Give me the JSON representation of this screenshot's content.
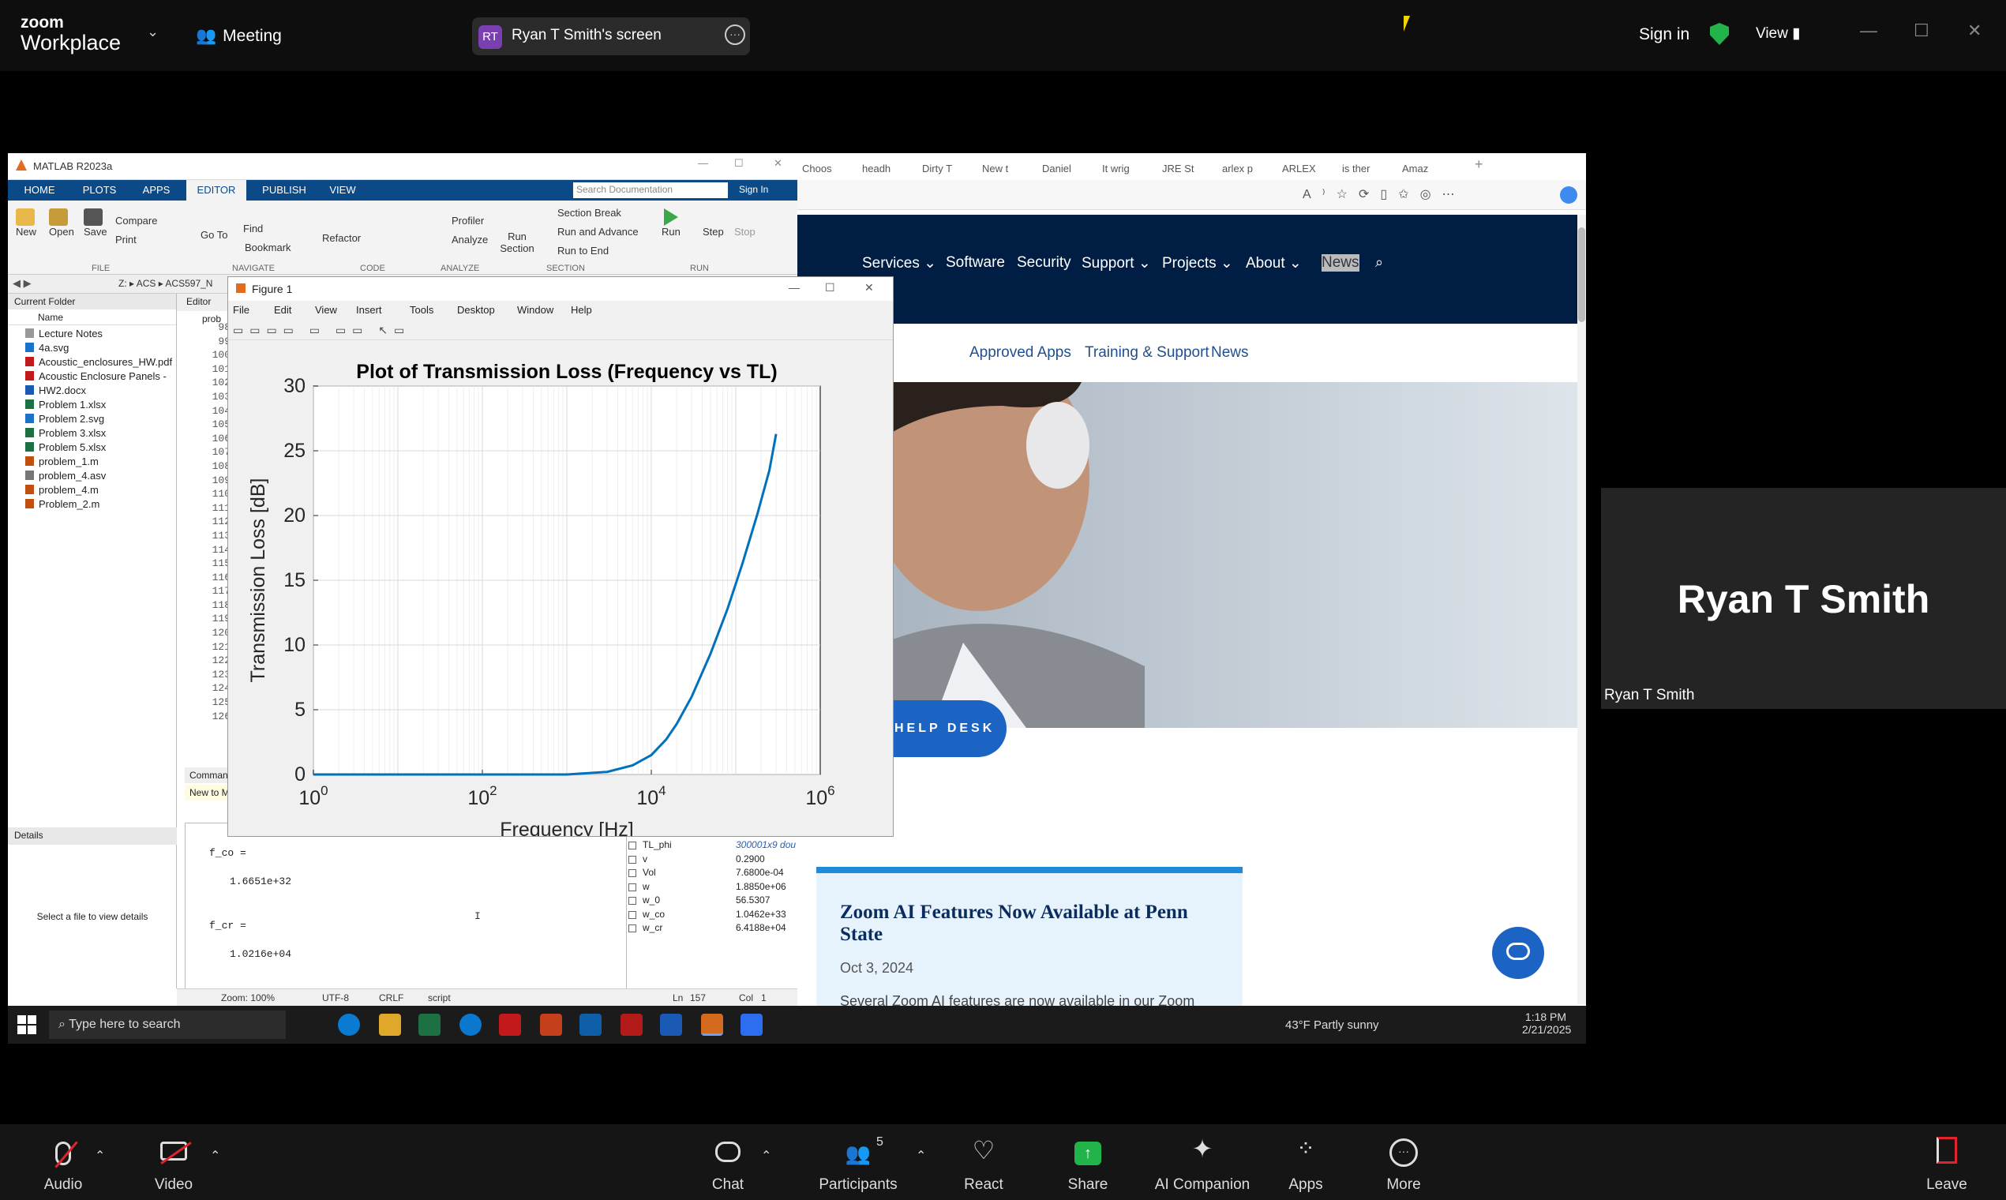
{
  "zoom": {
    "brand_top": "zoom",
    "brand_bottom": "Workplace",
    "meeting_label": "Meeting",
    "share_avatar": "RT",
    "share_label": "Ryan T Smith's screen",
    "sign_in": "Sign in",
    "view": "View",
    "tile_name_large": "Ryan T Smith",
    "tile_name_small": "Ryan T Smith",
    "bottom": [
      {
        "label": "Audio",
        "icon": "muted-mic-icon"
      },
      {
        "label": "Video",
        "icon": "video-off-icon"
      },
      {
        "label": "Chat",
        "icon": "chat-icon"
      },
      {
        "label": "Participants",
        "icon": "participants-icon",
        "count": "5"
      },
      {
        "label": "React",
        "icon": "heart-icon"
      },
      {
        "label": "Share",
        "icon": "share-icon"
      },
      {
        "label": "AI Companion",
        "icon": "sparkle-icon"
      },
      {
        "label": "Apps",
        "icon": "apps-icon"
      },
      {
        "label": "More",
        "icon": "more-icon"
      },
      {
        "label": "Leave",
        "icon": "leave-icon"
      }
    ]
  },
  "matlab": {
    "title": "MATLAB R2023a",
    "tabs": [
      "HOME",
      "PLOTS",
      "APPS",
      "EDITOR",
      "PUBLISH",
      "VIEW"
    ],
    "search_placeholder": "Search Documentation",
    "sign_in": "Sign In",
    "ribbon": {
      "new": "New",
      "open": "Open",
      "save": "Save",
      "compare": "Compare",
      "print": "Print",
      "goto": "Go To",
      "find": "Find",
      "bookmark": "Bookmark",
      "refactor": "Refactor",
      "profiler": "Profiler",
      "analyze": "Analyze",
      "run_section": "Run Section",
      "section_break": "Section Break",
      "run_advance": "Run and Advance",
      "run_end": "Run to End",
      "run": "Run",
      "step": "Step",
      "stop": "Stop"
    },
    "groups": [
      "FILE",
      "NAVIGATE",
      "CODE",
      "ANALYZE",
      "SECTION",
      "RUN"
    ],
    "path": [
      "Z:",
      "ACS",
      "ACS597_N"
    ],
    "current_folder": "Current Folder",
    "name_col": "Name",
    "files": [
      "Lecture Notes",
      "4a.svg",
      "Acoustic_enclosures_HW.pdf",
      "Acoustic Enclosure Panels - ...",
      "HW2.docx",
      "Problem 1.xlsx",
      "Problem 2.svg",
      "Problem 3.xlsx",
      "Problem 5.xlsx",
      "problem_1.m",
      "problem_4.asv",
      "problem_4.m",
      "Problem_2.m"
    ],
    "details": "Details",
    "details_msg": "Select a file to view details",
    "editor_tab": "Editor",
    "editor_file": "prob",
    "line_numbers": [
      "98",
      "99",
      "100",
      "101",
      "102",
      "103",
      "104",
      "105",
      "106",
      "107",
      "108",
      "109",
      "110",
      "111",
      "112",
      "113",
      "114",
      "115",
      "116",
      "117",
      "118",
      "119",
      "120",
      "121",
      "122",
      "123",
      "124",
      "125",
      "126"
    ],
    "command_label": "Comman",
    "new_to": "New to M",
    "cmd_lines": [
      "f_co =",
      "1.6651e+32",
      "f_cr =",
      "1.0216e+04"
    ],
    "prompt": ">>",
    "workspace": [
      {
        "name": "TL_phi",
        "value": "300001x9 dou"
      },
      {
        "name": "v",
        "value": "0.2900"
      },
      {
        "name": "Vol",
        "value": "7.6800e-04"
      },
      {
        "name": "w",
        "value": "1.8850e+06"
      },
      {
        "name": "w_0",
        "value": "56.5307"
      },
      {
        "name": "w_co",
        "value": "1.0462e+33"
      },
      {
        "name": "w_cr",
        "value": "6.4188e+04"
      }
    ],
    "status": {
      "zoom": "Zoom: 100%",
      "enc": "UTF-8",
      "eol": "CRLF",
      "type": "script",
      "ln": "Ln",
      "ln_val": "157",
      "col": "Col",
      "col_val": "1"
    }
  },
  "figure": {
    "title": "Figure 1",
    "menus": [
      "File",
      "Edit",
      "View",
      "Insert",
      "Tools",
      "Desktop",
      "Window",
      "Help"
    ]
  },
  "chart_data": {
    "type": "line",
    "title": "Plot of Transmission Loss (Frequency vs TL)",
    "xlabel": "Frequency [Hz]",
    "ylabel": "Transmission Loss [dB]",
    "xscale": "log",
    "xlim": [
      1,
      1000000
    ],
    "ylim": [
      0,
      30
    ],
    "xticks": [
      "10^0",
      "10^2",
      "10^4",
      "10^6"
    ],
    "yticks": [
      "0",
      "5",
      "10",
      "15",
      "20",
      "25",
      "30"
    ],
    "grid": true,
    "color": "#0072bd",
    "x": [
      1,
      100,
      1000,
      3000,
      6000,
      10000,
      15000,
      20000,
      30000,
      50000,
      80000,
      120000,
      180000,
      250000,
      300000
    ],
    "y": [
      0,
      0,
      0,
      0.2,
      0.7,
      1.5,
      2.7,
      3.9,
      6.0,
      9.3,
      12.8,
      16.3,
      20.1,
      23.5,
      26.3
    ]
  },
  "browser": {
    "tabs": [
      "Choos",
      "headh",
      "Dirty T",
      "New t",
      "Daniel",
      "It wrig",
      "JRE St",
      "arlex p",
      "ARLEX",
      "is ther",
      "Amaz"
    ],
    "nav": [
      "Services",
      "Software",
      "Security",
      "Support",
      "Projects",
      "About",
      "News"
    ],
    "subnav": [
      "Approved Apps",
      "Training & Support",
      "News"
    ],
    "help_desk": "HELP DESK",
    "card_title": "Zoom AI Features Now Available at Penn State",
    "card_date": "Oct 3, 2024",
    "card_text": "Several Zoom AI features are now available in our Zoom"
  },
  "windows": {
    "search": "Type here to search",
    "weather": "43°F  Partly sunny",
    "time": "1:18 PM",
    "date": "2/21/2025"
  }
}
